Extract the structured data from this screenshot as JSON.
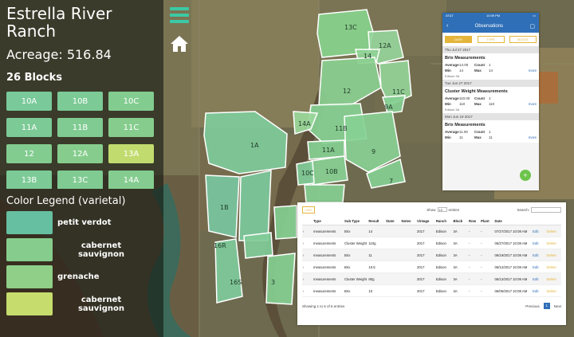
{
  "farm": {
    "name": "Estrella River Ranch",
    "acreage": "Acreage: 516.84",
    "blocks_count": "26 Blocks"
  },
  "blocks": [
    {
      "label": "10A",
      "color": "#79c99a"
    },
    {
      "label": "10B",
      "color": "#7cca96"
    },
    {
      "label": "10C",
      "color": "#82cc90"
    },
    {
      "label": "11A",
      "color": "#7cca96"
    },
    {
      "label": "11B",
      "color": "#80cb92"
    },
    {
      "label": "11C",
      "color": "#86cd8d"
    },
    {
      "label": "12",
      "color": "#82cc90"
    },
    {
      "label": "12A",
      "color": "#86cd8d"
    },
    {
      "label": "13A",
      "color": "#c2db6e"
    },
    {
      "label": "13B",
      "color": "#7cca96"
    },
    {
      "label": "13C",
      "color": "#80cb92"
    },
    {
      "label": "14A",
      "color": "#84cc8f"
    }
  ],
  "legend": {
    "title": "Color Legend (varietal)",
    "items": [
      {
        "label": "petit verdot",
        "color": "#66bfa0"
      },
      {
        "label": "cabernet sauvignon",
        "color": "#86cd8d"
      },
      {
        "label": "grenache",
        "color": "#8fcf88"
      },
      {
        "label": "cabernet sauvignon",
        "color": "#c6dc6d"
      }
    ]
  },
  "map_blocks": [
    {
      "label": "13C"
    },
    {
      "label": "12A"
    },
    {
      "label": "14"
    },
    {
      "label": "12"
    },
    {
      "label": "11C"
    },
    {
      "label": "9A"
    },
    {
      "label": "11B"
    },
    {
      "label": "1A"
    },
    {
      "label": "14A"
    },
    {
      "label": "11A"
    },
    {
      "label": "9"
    },
    {
      "label": "10B"
    },
    {
      "label": "10C"
    },
    {
      "label": "1B"
    },
    {
      "label": "16S"
    },
    {
      "label": "16R"
    },
    {
      "label": "3"
    },
    {
      "label": "7"
    }
  ],
  "observations": {
    "status_carrier": "AT&T",
    "status_time": "10:09 PM",
    "title": "Observations",
    "back_icon": "arrow-left-icon",
    "map_icon": "map-icon",
    "tabs": [
      "DATE",
      "TYPE",
      "BLOCK"
    ],
    "entries": [
      {
        "date": "Thu Jul 27 2017",
        "title": "Brix Measurements",
        "average": "14.00",
        "count": "1",
        "min": "14",
        "max": "14",
        "location": "Edison 3A"
      },
      {
        "date": "Tue Jun 27 2017",
        "title": "Cluster Weight Measurements",
        "average": "110.00",
        "count": "1",
        "min": "110",
        "max": "110",
        "location": "Edison 3A"
      },
      {
        "date": "Mon Jun 19 2017",
        "title": "Brix Measurements",
        "average": "11.00",
        "count": "1",
        "min": "11",
        "max": "11",
        "location": ""
      }
    ],
    "labels": {
      "average": "Average",
      "count": "Count",
      "min": "Min",
      "max": "Max",
      "more": "more"
    },
    "fab": "+"
  },
  "table": {
    "csv_label": "CSV",
    "show_label": "Show",
    "show_value": "10",
    "entries_label": "entries",
    "search_label": "Search:",
    "columns": [
      "",
      "Type",
      "Sub Type",
      "Result",
      "State",
      "Notes",
      "Vintage",
      "Ranch",
      "Block",
      "Row",
      "Plant",
      "Date",
      "",
      ""
    ],
    "rows": [
      [
        "›",
        "measurements",
        "Brix",
        "14",
        "",
        "",
        "2017",
        "Edison",
        "3A",
        "-",
        "-",
        "07/27/2017 10:08 AM",
        "Edit",
        "Delete"
      ],
      [
        "›",
        "measurements",
        "Cluster Weight",
        "110g",
        "",
        "",
        "2017",
        "Edison",
        "3A",
        "-",
        "-",
        "06/27/2017 10:08 AM",
        "Edit",
        "Delete"
      ],
      [
        "›",
        "measurements",
        "Brix",
        "11",
        "",
        "",
        "2017",
        "Edison",
        "3A",
        "-",
        "-",
        "06/19/2017 10:08 AM",
        "Edit",
        "Delete"
      ],
      [
        "›",
        "measurements",
        "Brix",
        "10.5",
        "",
        "",
        "2017",
        "Edison",
        "3A",
        "-",
        "-",
        "06/12/2017 10:08 AM",
        "Edit",
        "Delete"
      ],
      [
        "›",
        "measurements",
        "Cluster Weight",
        "80g",
        "",
        "",
        "2017",
        "Edison",
        "3A",
        "-",
        "-",
        "06/12/2017 10:08 AM",
        "Edit",
        "Delete"
      ],
      [
        "›",
        "measurements",
        "Brix",
        "10",
        "",
        "",
        "2017",
        "Edison",
        "3A",
        "-",
        "-",
        "06/06/2017 10:08 AM",
        "Edit",
        "Delete"
      ]
    ],
    "footer_info": "Showing 1 to 6 of 6 entries",
    "pager": {
      "prev": "Previous",
      "current": "1",
      "next": "Next"
    }
  },
  "colors": {
    "accent_teal": "#3cc8a4",
    "ios_blue": "#2f6fb7",
    "gold": "#e4b53a"
  }
}
